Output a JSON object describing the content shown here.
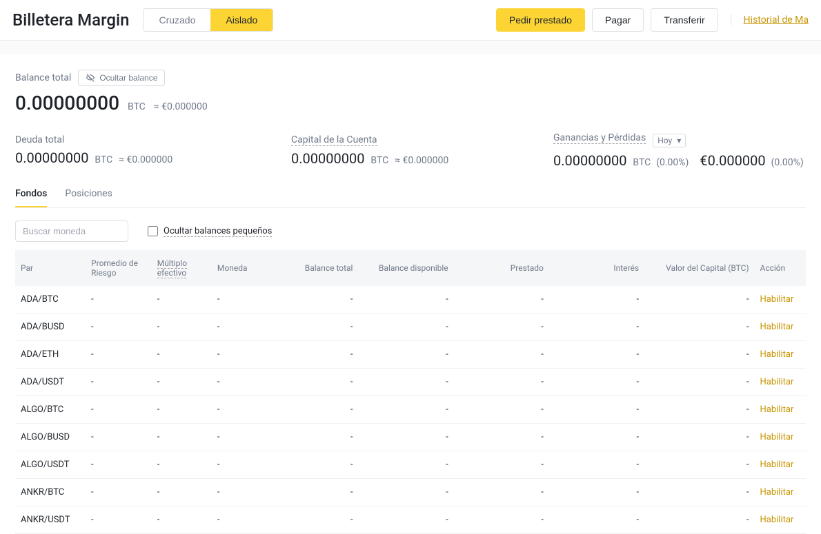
{
  "header": {
    "title": "Billetera Margin",
    "tabs": {
      "cross": "Cruzado",
      "isolated": "Aislado"
    },
    "buttons": {
      "borrow": "Pedir prestado",
      "pay": "Pagar",
      "transfer": "Transferir"
    },
    "history_link": "Historial de Ma"
  },
  "balance": {
    "total_label": "Balance total",
    "hide_btn": "Ocultar balance",
    "total_value": "0.00000000",
    "total_unit": "BTC",
    "total_approx": "≈ €0.000000"
  },
  "stats": {
    "debt": {
      "label": "Deuda total",
      "value": "0.00000000",
      "unit": "BTC",
      "approx": "≈ €0.000000"
    },
    "equity": {
      "label": "Capital de la Cuenta",
      "value": "0.00000000",
      "unit": "BTC",
      "approx": "≈ €0.000000"
    },
    "pnl": {
      "label": "Ganancias y Pérdidas",
      "period": "Hoy",
      "btc_value": "0.00000000",
      "btc_unit": "BTC",
      "btc_pct": "(0.00%)",
      "eur_value": "€0.000000",
      "eur_pct": "(0.00%)"
    }
  },
  "subtabs": {
    "funds": "Fondos",
    "positions": "Posiciones"
  },
  "filter": {
    "search_placeholder": "Buscar moneda",
    "hide_small": "Ocultar balances pequeños"
  },
  "table": {
    "headers": {
      "pair": "Par",
      "risk": "Promedio de Riesgo",
      "mult": "Múltiplo efectivo",
      "coin": "Moneda",
      "total": "Balance total",
      "avail": "Balance disponible",
      "borrowed": "Prestado",
      "interest": "Interés",
      "equity": "Valor del Capital (BTC)",
      "action": "Acción"
    },
    "rows": [
      {
        "pair": "ADA/BTC",
        "risk": "-",
        "mult": "-",
        "coin": "-",
        "total": "-",
        "avail": "-",
        "borrowed": "-",
        "interest": "-",
        "equity": "-",
        "action": "Habilitar"
      },
      {
        "pair": "ADA/BUSD",
        "risk": "-",
        "mult": "-",
        "coin": "-",
        "total": "-",
        "avail": "-",
        "borrowed": "-",
        "interest": "-",
        "equity": "-",
        "action": "Habilitar"
      },
      {
        "pair": "ADA/ETH",
        "risk": "-",
        "mult": "-",
        "coin": "-",
        "total": "-",
        "avail": "-",
        "borrowed": "-",
        "interest": "-",
        "equity": "-",
        "action": "Habilitar"
      },
      {
        "pair": "ADA/USDT",
        "risk": "-",
        "mult": "-",
        "coin": "-",
        "total": "-",
        "avail": "-",
        "borrowed": "-",
        "interest": "-",
        "equity": "-",
        "action": "Habilitar"
      },
      {
        "pair": "ALGO/BTC",
        "risk": "-",
        "mult": "-",
        "coin": "-",
        "total": "-",
        "avail": "-",
        "borrowed": "-",
        "interest": "-",
        "equity": "-",
        "action": "Habilitar"
      },
      {
        "pair": "ALGO/BUSD",
        "risk": "-",
        "mult": "-",
        "coin": "-",
        "total": "-",
        "avail": "-",
        "borrowed": "-",
        "interest": "-",
        "equity": "-",
        "action": "Habilitar"
      },
      {
        "pair": "ALGO/USDT",
        "risk": "-",
        "mult": "-",
        "coin": "-",
        "total": "-",
        "avail": "-",
        "borrowed": "-",
        "interest": "-",
        "equity": "-",
        "action": "Habilitar"
      },
      {
        "pair": "ANKR/BTC",
        "risk": "-",
        "mult": "-",
        "coin": "-",
        "total": "-",
        "avail": "-",
        "borrowed": "-",
        "interest": "-",
        "equity": "-",
        "action": "Habilitar"
      },
      {
        "pair": "ANKR/USDT",
        "risk": "-",
        "mult": "-",
        "coin": "-",
        "total": "-",
        "avail": "-",
        "borrowed": "-",
        "interest": "-",
        "equity": "-",
        "action": "Habilitar"
      }
    ]
  }
}
